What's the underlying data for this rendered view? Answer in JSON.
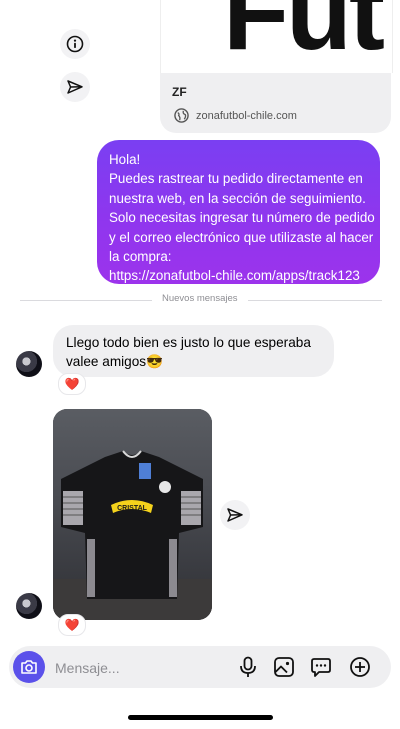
{
  "link_preview": {
    "image_text": "Fut",
    "site_name": "ZF",
    "domain": "zonafutbol-chile.com"
  },
  "outgoing_message": {
    "text": "Hola!\nPuedes rastrear tu pedido directamente en nuestra web, en la sección de seguimiento. Solo necesitas ingresar tu número de pedido y el correo electrónico que utilizaste al hacer la compra:\nhttps://zonafutbol-chile.com/apps/track123"
  },
  "divider": {
    "label": "Nuevos mensajes"
  },
  "incoming_message": {
    "text": "Llego todo bien es justo lo que esperaba valee amigos😎",
    "reaction": "❤️"
  },
  "photo_message": {
    "jersey_brand": "CRISTAL",
    "reaction": "❤️"
  },
  "composer": {
    "placeholder": "Mensaje..."
  },
  "colors": {
    "bubble_gradient_top": "#7a3ff2",
    "bubble_gradient_bottom": "#9c33ec",
    "camera_button": "#5b51ea",
    "incoming_bubble": "#efeff1"
  },
  "icons": {
    "info": "info-circle-icon",
    "share": "paper-plane-icon",
    "globe": "globe-icon",
    "mic": "microphone-icon",
    "gallery": "image-icon",
    "sticker": "chat-bubble-icon",
    "add": "plus-circle-icon"
  }
}
